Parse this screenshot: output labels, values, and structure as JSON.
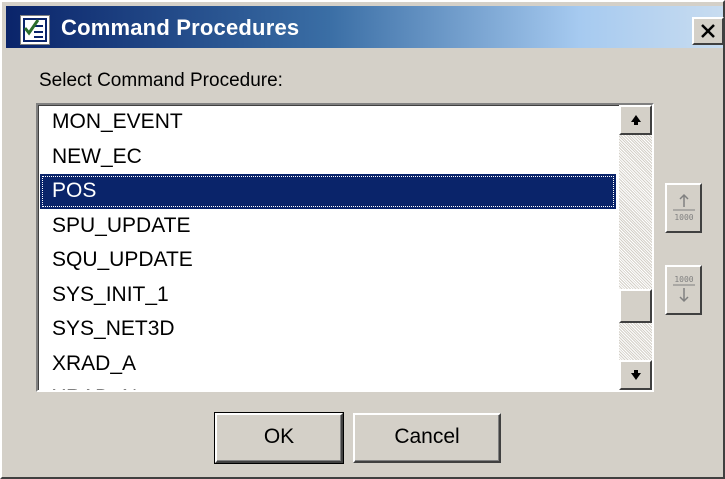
{
  "window": {
    "title": "Command Procedures",
    "title_icon": "checklist-icon",
    "close_icon": "close-icon"
  },
  "prompt": "Select Command Procedure:",
  "procedures": {
    "items": [
      "MON_EVENT",
      "NEW_EC",
      "POS",
      "SPU_UPDATE",
      "SQU_UPDATE",
      "SYS_INIT_1",
      "SYS_NET3D",
      "XRAD_A",
      "XRAD_N"
    ],
    "selected": "POS"
  },
  "scrollbar": {
    "up_icon": "arrow-up-icon",
    "down_icon": "arrow-down-icon"
  },
  "side_buttons": {
    "move_up_icon": "move-up-icon",
    "move_down_icon": "move-down-icon"
  },
  "buttons": {
    "ok": "OK",
    "cancel": "Cancel"
  },
  "colors": {
    "selection": "#0a246a",
    "titlebar_start": "#0a246a",
    "face": "#d4d0c8"
  }
}
